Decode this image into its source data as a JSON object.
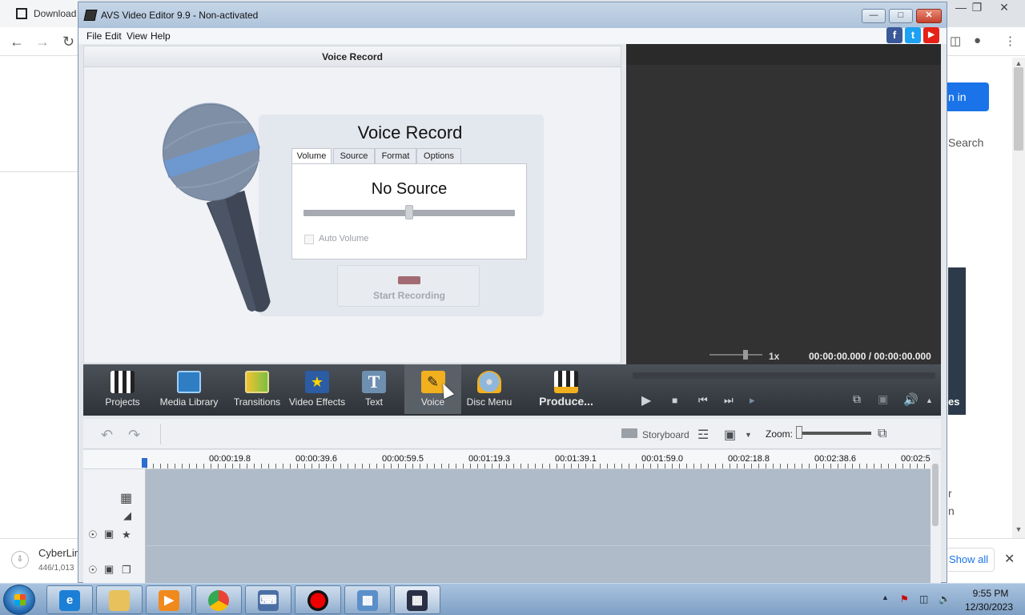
{
  "browser": {
    "tab_title": "Download",
    "sign_in": "n in",
    "search": "Search",
    "side_label": "es",
    "frag_1": "r",
    "frag_2": "n",
    "download_name": "CyberLin",
    "download_size": "446/1,013",
    "show_all": "Show all"
  },
  "window": {
    "title": "AVS Video Editor 9.9 - Non-activated",
    "minimize": "—",
    "maximize": "□",
    "close": "✕"
  },
  "menu": [
    "File",
    "Edit",
    "View",
    "Help"
  ],
  "social": {
    "facebook": "f",
    "twitter": "t",
    "youtube": "▶",
    "colors": {
      "facebook": "#3b5998",
      "twitter": "#1da1f2",
      "youtube": "#e62117"
    }
  },
  "voice_panel": {
    "header": "Voice Record",
    "title": "Voice Record",
    "tabs": [
      "Volume",
      "Source",
      "Format",
      "Options"
    ],
    "active_tab": "Volume",
    "source_status": "No Source",
    "volume_level": 0.5,
    "auto_volume_label": "Auto Volume",
    "auto_volume_checked": false,
    "start_button": "Start Recording"
  },
  "preview": {
    "speed": "1x",
    "time": "00:00:00.000  /  00:00:00.000"
  },
  "modules": [
    {
      "label": "Projects",
      "icon": "clapperboard-icon"
    },
    {
      "label": "Media Library",
      "icon": "film-library-icon"
    },
    {
      "label": "Transitions",
      "icon": "transitions-icon"
    },
    {
      "label": "Video Effects",
      "icon": "star-effects-icon"
    },
    {
      "label": "Text",
      "icon": "text-t-icon"
    },
    {
      "label": "Voice",
      "icon": "microphone-icon"
    },
    {
      "label": "Disc Menu",
      "icon": "disc-icon"
    },
    {
      "label": "Produce...",
      "icon": "produce-icon"
    }
  ],
  "active_module": "Voice",
  "timeline": {
    "storyboard": "Storyboard",
    "zoom_label": "Zoom:",
    "ruler": [
      "00:00:19.8",
      "00:00:39.6",
      "00:00:59.5",
      "00:01:19.3",
      "00:01:39.1",
      "00:01:59.0",
      "00:02:18.8",
      "00:02:38.6",
      "00:02:5"
    ]
  },
  "taskbar": {
    "time": "9:55 PM",
    "date": "12/30/2023"
  }
}
